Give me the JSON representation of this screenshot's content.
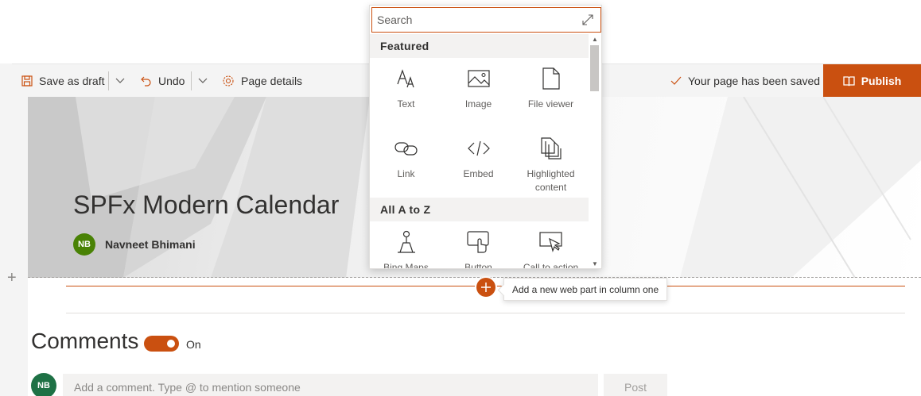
{
  "toolbar": {
    "save_draft": "Save as draft",
    "undo": "Undo",
    "page_details": "Page details",
    "save_status": "Your page has been saved",
    "publish": "Publish"
  },
  "hero": {
    "title": "SPFx Modern Calendar",
    "author_initials": "NB",
    "author_name": "Navneet Bhimani"
  },
  "section": {
    "add_tooltip": "Add a new web part in column one"
  },
  "toolbox": {
    "search_placeholder": "Search",
    "featured_heading": "Featured",
    "featured_items": [
      {
        "label": "Text",
        "icon": "text-icon"
      },
      {
        "label": "Image",
        "icon": "image-icon"
      },
      {
        "label": "File viewer",
        "icon": "file-viewer-icon"
      },
      {
        "label": "Link",
        "icon": "link-icon"
      },
      {
        "label": "Embed",
        "icon": "embed-icon"
      },
      {
        "label": "Highlighted content",
        "icon": "highlighted-content-icon"
      }
    ],
    "az_heading": "All A to Z",
    "az_items": [
      {
        "label": "Bing Maps",
        "icon": "bing-maps-icon"
      },
      {
        "label": "Button",
        "icon": "button-icon"
      },
      {
        "label": "Call to action",
        "icon": "call-to-action-icon"
      }
    ]
  },
  "comments": {
    "title": "Comments",
    "toggle_label": "On",
    "user_initials": "NB",
    "input_placeholder": "Add a comment. Type @ to mention someone",
    "post_label": "Post"
  },
  "colors": {
    "accent": "#ca5010",
    "avatar_green": "#498205",
    "comment_avatar": "#1e7145"
  }
}
